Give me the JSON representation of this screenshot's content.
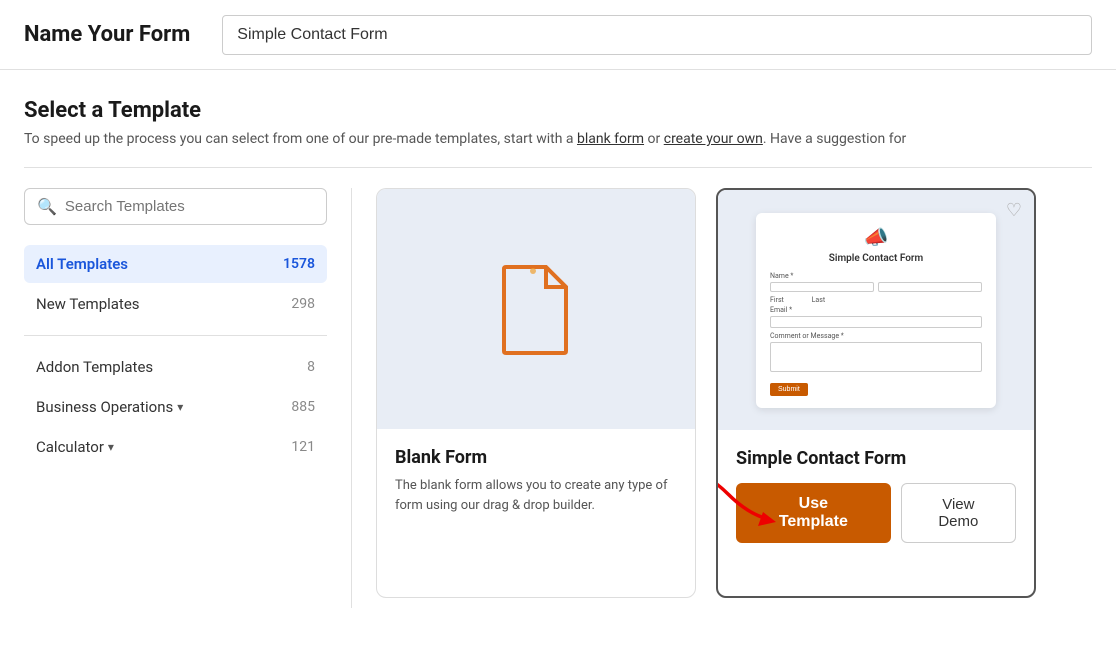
{
  "header": {
    "title": "Name Your Form",
    "input_value": "Simple Contact Form",
    "input_placeholder": "Simple Contact Form"
  },
  "select_template": {
    "section_title": "Select a Template",
    "section_desc": "To speed up the process you can select from one of our pre-made templates, start with a blank form or create your own. Have a suggestion for"
  },
  "sidebar": {
    "search_placeholder": "Search Templates",
    "items": [
      {
        "label": "All Templates",
        "count": "1578",
        "active": true
      },
      {
        "label": "New Templates",
        "count": "298",
        "active": false
      }
    ],
    "categories": [
      {
        "label": "Addon Templates",
        "count": "8",
        "has_chevron": false
      },
      {
        "label": "Business Operations",
        "count": "885",
        "has_chevron": true
      },
      {
        "label": "Calculator",
        "count": "121",
        "has_chevron": true
      }
    ]
  },
  "templates": {
    "blank_card": {
      "name": "Blank Form",
      "description": "The blank form allows you to create any type of form using our drag & drop builder."
    },
    "selected_card": {
      "name": "Simple Contact Form",
      "mini_form_title": "Simple Contact Form",
      "fields": [
        "Name",
        "First",
        "Last",
        "Email",
        "Comment or Message"
      ]
    },
    "buttons": {
      "use_template": "Use Template",
      "view_demo": "View Demo"
    }
  },
  "icons": {
    "search": "🔍",
    "heart": "♡",
    "megaphone": "📣"
  }
}
